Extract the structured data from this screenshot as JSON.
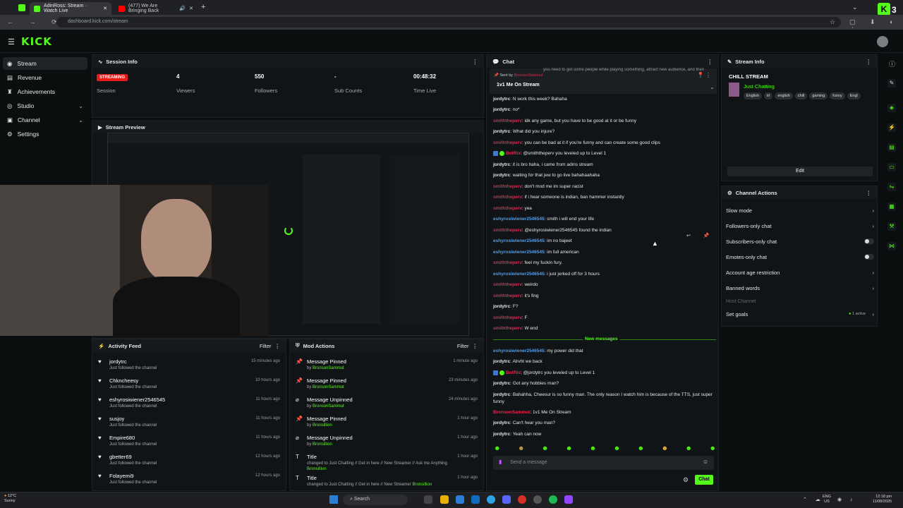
{
  "browser": {
    "tabs": [
      {
        "title": "AdinRoss: Stream · Watch Live"
      },
      {
        "title": "(477) We Are Bringing Back"
      }
    ],
    "url": "dashboard.kick.com/stream",
    "new_tab": "+"
  },
  "brand": {
    "logo": "KICK",
    "accent": "#53fc18"
  },
  "sidebar": {
    "items": [
      {
        "label": "Stream",
        "icon": "broadcast-icon",
        "active": true
      },
      {
        "label": "Revenue",
        "icon": "revenue-icon"
      },
      {
        "label": "Achievements",
        "icon": "trophy-icon"
      },
      {
        "label": "Studio",
        "icon": "studio-icon",
        "expand": "⌄"
      },
      {
        "label": "Channel",
        "icon": "channel-icon",
        "expand": "⌄"
      },
      {
        "label": "Settings",
        "icon": "gear-icon"
      }
    ]
  },
  "session": {
    "title": "Session Info",
    "badge": "STREAMING",
    "stats": [
      {
        "label": "Session",
        "value": ""
      },
      {
        "label": "Viewers",
        "value": "4"
      },
      {
        "label": "Followers",
        "value": "550"
      },
      {
        "label": "Sub Counts",
        "value": "-"
      },
      {
        "label": "Time Live",
        "value": "00:48:32"
      }
    ]
  },
  "preview": {
    "title": "Stream Preview"
  },
  "activity": {
    "title": "Activity Feed",
    "filter": "Filter",
    "items": [
      {
        "name": "jordytrc",
        "sub": "Just followed the channel",
        "time": "15 minutes ago"
      },
      {
        "name": "Chkncheesy",
        "sub": "Just followed the channel",
        "time": "10 hours ago"
      },
      {
        "name": "eshyrosiwiener2546545",
        "sub": "Just followed the channel",
        "time": "11 hours ago"
      },
      {
        "name": "susjoy",
        "sub": "Just followed the channel",
        "time": "11 hours ago"
      },
      {
        "name": "Empire680",
        "sub": "Just followed the channel",
        "time": "11 hours ago"
      },
      {
        "name": "gbetter69",
        "sub": "Just followed the channel",
        "time": "12 hours ago"
      },
      {
        "name": "Folayemi9",
        "sub": "Just followed the channel",
        "time": "12 hours ago"
      }
    ]
  },
  "modactions": {
    "title": "Mod Actions",
    "filter": "Filter",
    "items": [
      {
        "icon": "pin-icon",
        "name": "Message Pinned",
        "by": "by",
        "user": "BronsonSammut",
        "time": "1 minute ago"
      },
      {
        "icon": "pin-icon",
        "name": "Message Pinned",
        "by": "by",
        "user": "BronsonSammut",
        "time": "23 minutes ago"
      },
      {
        "icon": "unpin-icon",
        "name": "Message Unpinned",
        "by": "by",
        "user": "BronsonSammut",
        "time": "24 minutes ago"
      },
      {
        "icon": "pin-icon",
        "name": "Message Pinned",
        "by": "by",
        "user": "Bronsillion",
        "time": "1 hour ago"
      },
      {
        "icon": "unpin-icon",
        "name": "Message Unpinned",
        "by": "by",
        "user": "Bronsillion",
        "time": "1 hour ago"
      },
      {
        "icon": "title-icon",
        "name": "Title",
        "by": "changed to",
        "user": "Just Chatting // Get in here // New Streamer // Ask me Anything",
        "user2": "Bronsillion",
        "time": "1 hour ago"
      },
      {
        "icon": "title-icon",
        "name": "Title",
        "by": "changed to",
        "user": "Just Chatting // Get in here // New Streamer",
        "user2": "Bronsillion",
        "time": "1 hour ago"
      }
    ]
  },
  "chat": {
    "title": "Chat",
    "pinned_by": "Sent by",
    "pinned_user": "BronsonSammut",
    "pinned_text": "1v1 Me On Stream",
    "pinned_bg_text": "you need to get some people while playing something, attract new audience, and then",
    "new_messages": "New messages",
    "input_placeholder": "Send a message",
    "send_label": "Chat",
    "messages": [
      {
        "user": "jordytrc",
        "color": "#e6e6e6",
        "text": ": N work this week? Bahaha"
      },
      {
        "user": "jordytrc",
        "color": "#e6e6e6",
        "text": ": no*"
      },
      {
        "user": "smiththeperv",
        "color": "#e0284f",
        "text": ": idk any game, but you have to be good at it or be funny"
      },
      {
        "user": "jordytrc",
        "color": "#e6e6e6",
        "text": ": What did you injure?"
      },
      {
        "user": "smiththeperv",
        "color": "#e0284f",
        "text": ": you can be bad at it if you're funny and can create some good clips"
      },
      {
        "user": "BotRix",
        "color": "#e0284f",
        "bot": true,
        "text": ": @smiththeperv you leveled up to Level 1"
      },
      {
        "user": "jordytrc",
        "color": "#e6e6e6",
        "text": ": it is bro haha, i came from adins stream"
      },
      {
        "user": "jordytrc",
        "color": "#e6e6e6",
        "text": ": waiting for that jew to go live bahahaahaha"
      },
      {
        "user": "smiththeperv",
        "color": "#e0284f",
        "text": ": don't mod me im super racist"
      },
      {
        "user": "smiththeperv",
        "color": "#e0284f",
        "text": ": if i hear someone is indian, ban hammer instantly"
      },
      {
        "user": "smiththeperv",
        "color": "#e0284f",
        "text": ": yea"
      },
      {
        "user": "eshyrosiwiener2546545",
        "color": "#4a9ff5",
        "text": ": smith i will end your life"
      },
      {
        "user": "smiththeperv",
        "color": "#e0284f",
        "text": ": @eshyrosiwiener2546545 found the indian"
      },
      {
        "user": "eshyrosiwiener2546545",
        "color": "#4a9ff5",
        "text": ": im no bajeet"
      },
      {
        "user": "eshyrosiwiener2546545",
        "color": "#4a9ff5",
        "text": ": im full american"
      },
      {
        "user": "smiththeperv",
        "color": "#e0284f",
        "text": ": feel my fuckin fury."
      },
      {
        "user": "eshyrosiwiener2546545",
        "color": "#4a9ff5",
        "text": ": i just jerked off for 3 hours"
      },
      {
        "user": "smiththeperv",
        "color": "#e0284f",
        "text": ": weirdo"
      },
      {
        "user": "smiththeperv",
        "color": "#e0284f",
        "text": ": it's fing"
      },
      {
        "user": "jordytrc",
        "color": "#e6e6e6",
        "text": ": F?"
      },
      {
        "user": "smiththeperv",
        "color": "#e0284f",
        "text": ": F"
      },
      {
        "user": "smiththeperv",
        "color": "#e0284f",
        "text": ": W end"
      }
    ],
    "new": [
      {
        "user": "eshyrosiwiener2546545",
        "color": "#4a9ff5",
        "text": ": my power did that"
      },
      {
        "user": "jordytrc",
        "color": "#e6e6e6",
        "text": ": Alrvht we back"
      },
      {
        "user": "BotRix",
        "color": "#e0284f",
        "bot": true,
        "text": ": @jordytrc you leveled up to Level 1"
      },
      {
        "user": "jordytrc",
        "color": "#e6e6e6",
        "text": ": Got any hobbies man?"
      },
      {
        "user": "jordytrc",
        "color": "#e6e6e6",
        "text": ": Bahahha, Cheesur is so funny man. The only reason I watch him is because of the TTS, just super funny"
      },
      {
        "user": "BronsonSammut",
        "color": "#e0284f",
        "text": ": 1v1 Me On Stream"
      },
      {
        "user": "jordytrc",
        "color": "#e6e6e6",
        "text": ": Can't hear you man?"
      },
      {
        "user": "jordytrc",
        "color": "#e6e6e6",
        "text": ": Yeah can now"
      }
    ]
  },
  "streaminfo": {
    "title": "Stream Info",
    "stream_title": "CHILL STREAM",
    "category": "Just Chatting",
    "tags": [
      "English",
      "irl",
      "english",
      "chill",
      "gaming",
      "funny",
      "Engl"
    ],
    "edit": "Edit"
  },
  "channelactions": {
    "title": "Channel Actions",
    "items": [
      {
        "label": "Slow mode",
        "type": "arrow"
      },
      {
        "label": "Followers-only chat",
        "type": "arrow"
      },
      {
        "label": "Subscribers-only chat",
        "type": "toggle"
      },
      {
        "label": "Emotes-only chat",
        "type": "toggle"
      },
      {
        "label": "Account age restriction",
        "type": "arrow"
      },
      {
        "label": "Banned words",
        "type": "arrow"
      },
      {
        "label": "Host Channel",
        "type": "none",
        "muted": true
      },
      {
        "label": "Set goals",
        "type": "arrow",
        "status": "1 active"
      }
    ]
  },
  "taskbar": {
    "weather_temp": "12°C",
    "weather_desc": "Sunny",
    "search": "Search",
    "lang1": "ENG",
    "lang2": "US",
    "time": "12:18 pm",
    "date": "11/08/2025"
  }
}
